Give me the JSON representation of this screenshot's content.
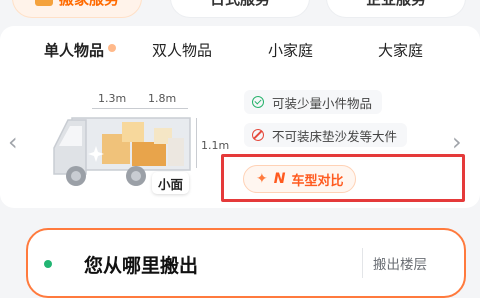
{
  "service_tabs": [
    {
      "label": "搬家服务",
      "active": true
    },
    {
      "label": "日式服务",
      "active": false
    },
    {
      "label": "企业服务",
      "active": false
    }
  ],
  "segments": [
    {
      "label": "单人物品",
      "active": true
    },
    {
      "label": "双人物品",
      "active": false
    },
    {
      "label": "小家庭",
      "active": false
    },
    {
      "label": "大家庭",
      "active": false
    }
  ],
  "vehicle": {
    "name": "小面",
    "length_front": "1.3m",
    "length_back": "1.8m",
    "height": "1.1m"
  },
  "features": [
    {
      "type": "ok",
      "text": "可装少量小件物品",
      "icon": "check-circle-icon"
    },
    {
      "type": "no",
      "text": "不可装床垫沙发等大件",
      "icon": "forbidden-icon"
    }
  ],
  "compare_button": {
    "label": "车型对比"
  },
  "address": {
    "title": "您从哪里搬出",
    "floor_label": "搬出楼层"
  },
  "colors": {
    "accent": "#ff6a00",
    "highlight_frame": "#e53a3a",
    "ok": "#27b26b",
    "no": "#e5483b"
  }
}
